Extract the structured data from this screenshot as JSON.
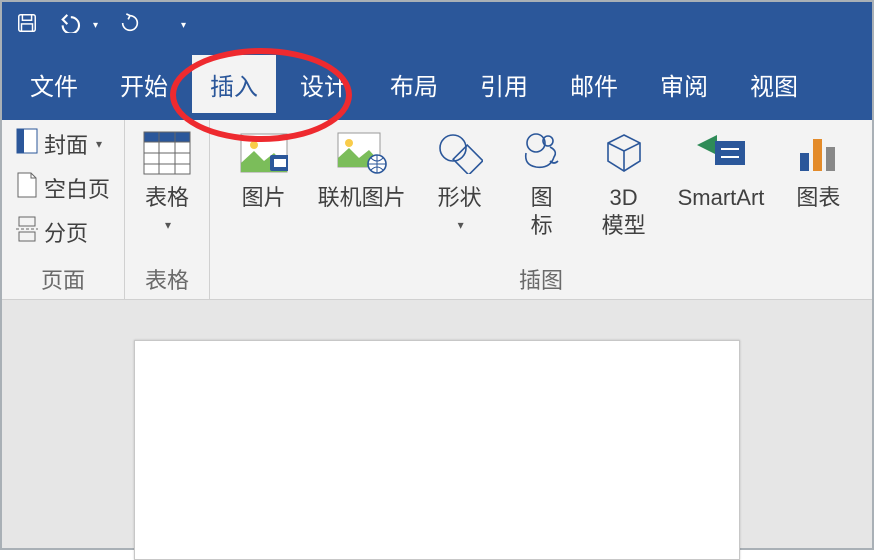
{
  "colors": {
    "brand": "#2b579a",
    "highlight": "#ee2a2f"
  },
  "tabs": {
    "file": "文件",
    "home": "开始",
    "insert": "插入",
    "design": "设计",
    "layout": "布局",
    "ref": "引用",
    "mail": "邮件",
    "review": "审阅",
    "view": "视图",
    "active": "insert"
  },
  "ribbon": {
    "groups": {
      "pages": {
        "label": "页面",
        "items": {
          "cover": "封面",
          "blankpage": "空白页",
          "pagebreak": "分页"
        }
      },
      "tables": {
        "label": "表格",
        "items": {
          "table": "表格"
        }
      },
      "illustrations": {
        "label": "插图",
        "items": {
          "picture": "图片",
          "onlinepic": "联机图片",
          "shapes": "形状",
          "icons": "图\n标",
          "model3d": "3D\n模型",
          "smartart": "SmartArt",
          "chart": "图表"
        }
      }
    }
  }
}
